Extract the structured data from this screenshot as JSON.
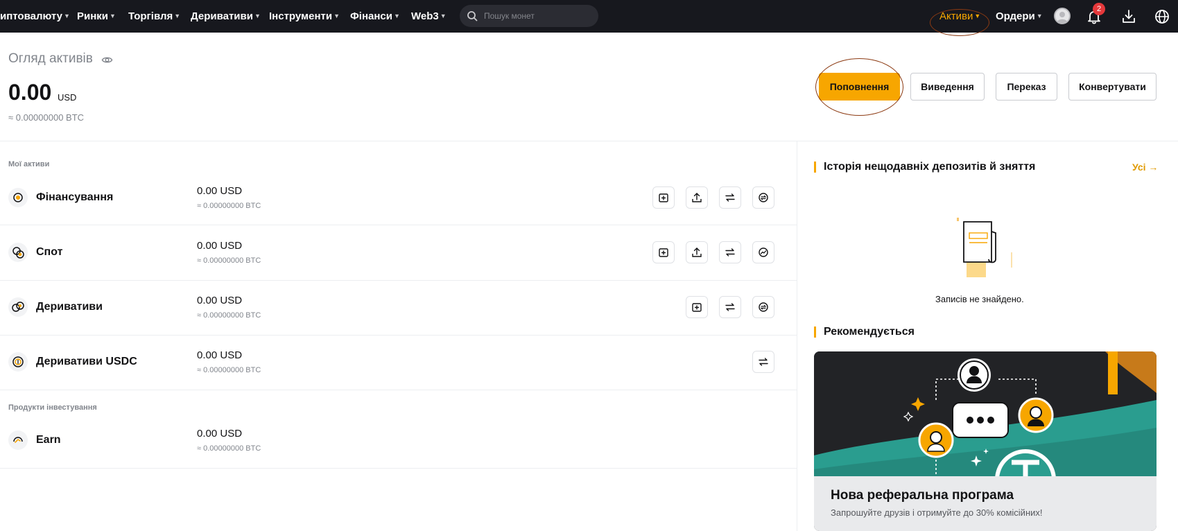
{
  "nav": {
    "items": [
      {
        "label": "иптовалюту",
        "name": "nav-crypto"
      },
      {
        "label": "Ринки",
        "name": "nav-markets"
      },
      {
        "label": "Торгівля",
        "name": "nav-trade"
      },
      {
        "label": "Деривативи",
        "name": "nav-derivatives"
      },
      {
        "label": "Інструменти",
        "name": "nav-tools"
      },
      {
        "label": "Фінанси",
        "name": "nav-finance"
      },
      {
        "label": "Web3",
        "name": "nav-web3"
      }
    ],
    "search_placeholder": "Пошук монет",
    "assets_label": "Активи",
    "orders_label": "Ордери",
    "notification_count": "2"
  },
  "overview": {
    "title": "Огляд активів",
    "total_value": "0.00",
    "total_unit": "USD",
    "total_btc": "≈ 0.00000000 BTC"
  },
  "actions": {
    "deposit": "Поповнення",
    "withdraw": "Виведення",
    "transfer": "Переказ",
    "convert": "Конвертувати"
  },
  "my_assets": {
    "label": "Мої активи",
    "accounts": [
      {
        "name": "Фінансування",
        "value": "0.00 USD",
        "btc": "≈ 0.00000000 BTC"
      },
      {
        "name": "Спот",
        "value": "0.00 USD",
        "btc": "≈ 0.00000000 BTC"
      },
      {
        "name": "Деривативи",
        "value": "0.00 USD",
        "btc": "≈ 0.00000000 BTC"
      },
      {
        "name": "Деривативи USDC",
        "value": "0.00 USD",
        "btc": "≈ 0.00000000 BTC"
      }
    ]
  },
  "invest": {
    "label": "Продукти інвестування",
    "accounts": [
      {
        "name": "Earn",
        "value": "0.00 USD",
        "btc": "≈ 0.00000000 BTC"
      }
    ]
  },
  "history": {
    "title": "Історія нещодавніх депозитів й зняття",
    "all_label": "Усі",
    "empty_text": "Записів не знайдено."
  },
  "recommended": {
    "title": "Рекомендується",
    "promo_title": "Нова реферальна програма",
    "promo_subtitle": "Запрошуйте друзів і отримуйте до 30% комісійних!"
  },
  "colors": {
    "accent": "#f7a600",
    "nav_bg": "#17181e",
    "badge": "#e5383b",
    "highlight_ring": "#8c3a12"
  }
}
